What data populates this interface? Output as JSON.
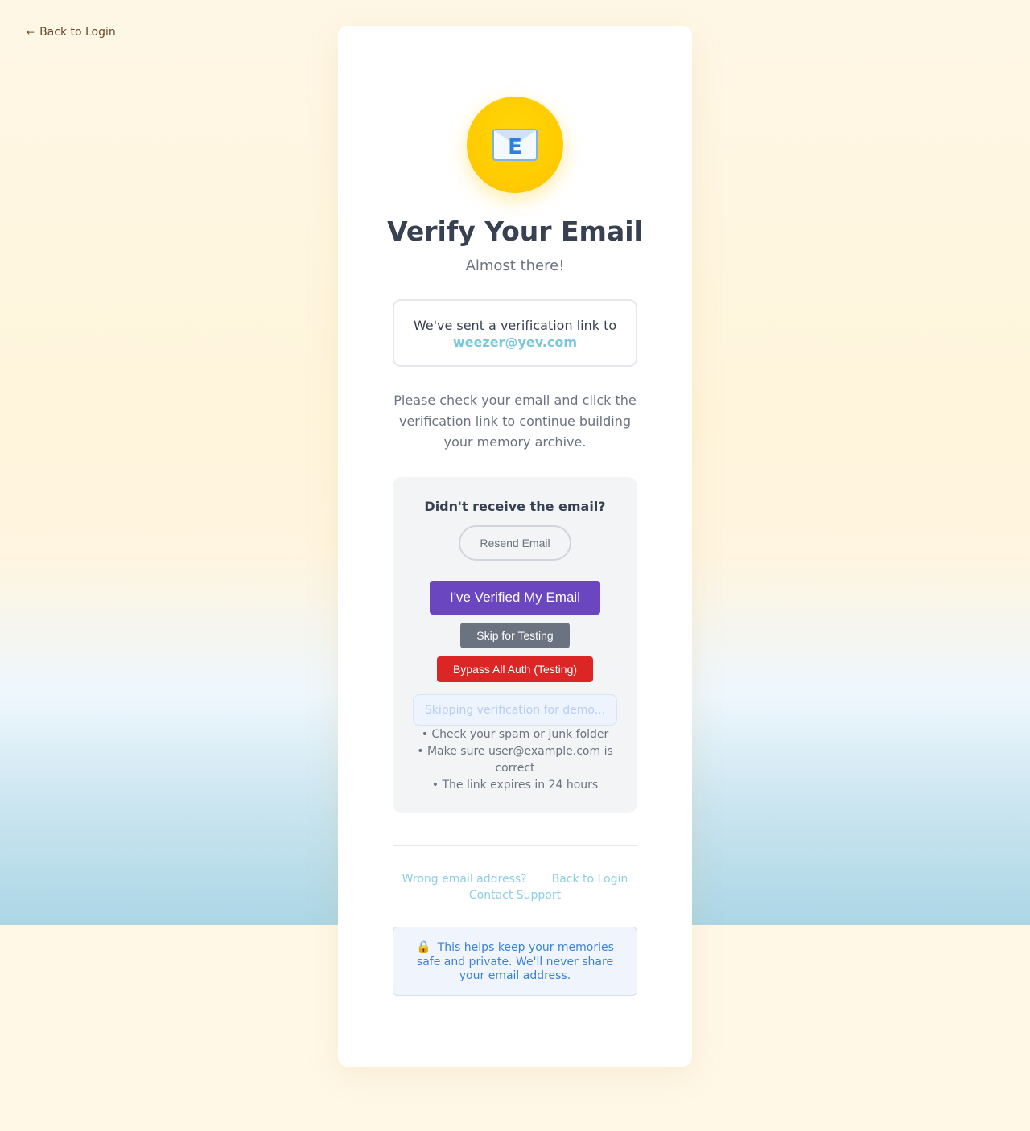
{
  "nav": {
    "back_label": "Back to Login",
    "back_arrow": "←"
  },
  "header": {
    "title": "Verify Your Email",
    "subtitle": "Almost there!",
    "icon": "envelope-icon",
    "icon_letter": "E"
  },
  "sent": {
    "text": "We've sent a verification link to",
    "email": "weezer@yev.com"
  },
  "instructions": "Please check your email and click the verification link to continue building your memory archive.",
  "help": {
    "title": "Didn't receive the email?",
    "resend_label": "Resend Email",
    "verified_label": "I've Verified My Email",
    "skip_label": "Skip for Testing",
    "bypass_label": "Bypass All Auth (Testing)",
    "status_text": "Skipping verification for demo...",
    "tips": [
      "• Check your spam or junk folder",
      "• Make sure user@example.com is correct",
      "• The link expires in 24 hours"
    ]
  },
  "links": {
    "wrong_email": "Wrong email address?",
    "back_to_login": "Back to Login",
    "contact_support": "Contact Support"
  },
  "privacy": {
    "icon": "lock-icon",
    "lock_glyph": "🔒",
    "text": "This helps keep your memories safe and private. We'll never share your email address."
  },
  "colors": {
    "primary": "#6b46c1",
    "danger": "#dc2626",
    "neutral": "#6b7280",
    "link": "#8ecfe3",
    "email_accent": "#7cc6dc",
    "icon_bg": "#ffcc00"
  }
}
